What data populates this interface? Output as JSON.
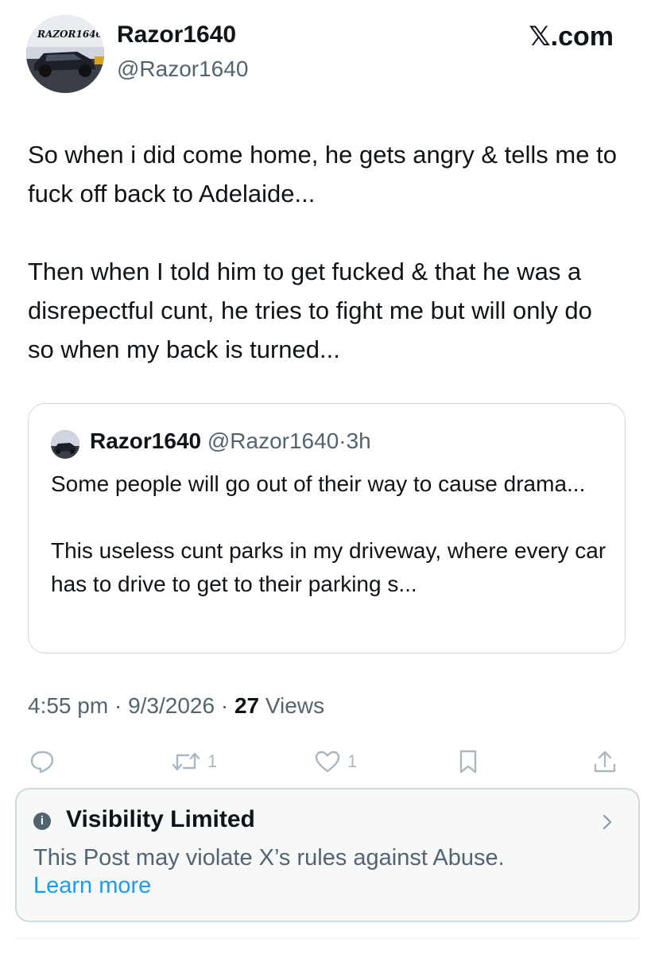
{
  "author": {
    "display_name": "Razor1640",
    "handle": "@Razor1640",
    "avatar_text": "RAZOR1640"
  },
  "brand": "𝕏.com",
  "post": {
    "paragraphs": [
      "So when i did come home, he gets angry & tells me to fuck off back to Adelaide...",
      "Then when I told him to get fucked & that he was a disrepectful cunt, he tries to fight me but will only do so when my back is turned..."
    ]
  },
  "quoted_post": {
    "display_name": "Razor1640",
    "handle": "@Razor1640",
    "separator": "·",
    "time": "3h",
    "paragraphs": [
      "Some people will go out of their way to cause drama...",
      "This useless cunt parks in my driveway, where every car has to drive to get to their parking s..."
    ]
  },
  "meta": {
    "time": "4:55 pm",
    "sep1": " · ",
    "date": "9/3/2026",
    "sep2": " · ",
    "views_count": "27",
    "views_label": " Views"
  },
  "actions": {
    "reply_count": "",
    "repost_count": "1",
    "like_count": "1"
  },
  "notice": {
    "title": "Visibility Limited",
    "text": "This Post may violate X’s rules against Abuse.",
    "link": "Learn more"
  },
  "colors": {
    "text_primary": "#0f1419",
    "text_secondary": "#536471",
    "link": "#1d9bf0",
    "border": "#cfd9de",
    "action_icon": "#aab8c2",
    "notice_bg": "#f7f9f9"
  }
}
